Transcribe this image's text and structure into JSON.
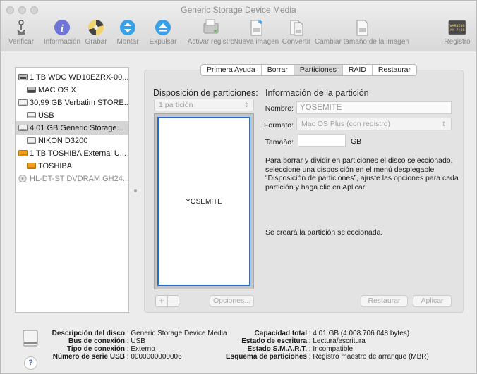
{
  "window": {
    "title": "Generic Storage Device Media"
  },
  "toolbar": {
    "items": [
      {
        "label": "Verificar",
        "icon": "stethoscope-icon"
      },
      {
        "label": "Información",
        "icon": "info-icon"
      },
      {
        "label": "Grabar",
        "icon": "burn-icon"
      },
      {
        "label": "Montar",
        "icon": "mount-icon"
      },
      {
        "label": "Expulsar",
        "icon": "eject-icon"
      },
      {
        "label": "Activar registro",
        "icon": "enable-journal-icon"
      },
      {
        "label": "Nueva imagen",
        "icon": "new-image-icon"
      },
      {
        "label": "Convertir",
        "icon": "convert-icon"
      },
      {
        "label": "Cambiar tamaño de la imagen",
        "icon": "resize-image-icon"
      },
      {
        "label": "Registro",
        "icon": "log-icon"
      }
    ],
    "log_icon_text": "WARNING\nAY 7:36"
  },
  "sidebar": {
    "items": [
      {
        "label": "1 TB WDC WD10EZRX-00...",
        "type": "internal-disk",
        "selected": false
      },
      {
        "label": "MAC OS X",
        "type": "volume",
        "selected": false
      },
      {
        "label": "30,99 GB Verbatim STORE...",
        "type": "external-disk",
        "selected": false
      },
      {
        "label": "USB",
        "type": "volume",
        "selected": false
      },
      {
        "label": "4,01 GB Generic Storage...",
        "type": "external-disk",
        "selected": true
      },
      {
        "label": "NIKON D3200",
        "type": "volume",
        "selected": false
      },
      {
        "label": "1 TB TOSHIBA External U...",
        "type": "orange-disk",
        "selected": false
      },
      {
        "label": "TOSHIBA",
        "type": "orange-volume",
        "selected": false
      },
      {
        "label": "HL-DT-ST DVDRAM GH24...",
        "type": "optical-drive",
        "selected": false
      }
    ]
  },
  "tabs": [
    {
      "label": "Primera Ayuda",
      "active": false
    },
    {
      "label": "Borrar",
      "active": false
    },
    {
      "label": "Particiones",
      "active": true
    },
    {
      "label": "RAID",
      "active": false
    },
    {
      "label": "Restaurar",
      "active": false
    }
  ],
  "partition": {
    "layout_title": "Disposición de particiones:",
    "layout_select": "1 partición",
    "partition_name": "YOSEMITE",
    "options_button": "Opciones...",
    "plus": "+",
    "minus": "—",
    "info_title": "Información de la partición",
    "name_label": "Nombre:",
    "name_value": "YOSEMITE",
    "format_label": "Formato:",
    "format_value": "Mac OS Plus (con registro)",
    "size_label": "Tamaño:",
    "size_value": "",
    "size_unit": "GB",
    "help_text": "Para borrar y dividir en particiones el disco seleccionado, seleccione una disposición en el menú desplegable “Disposición de particiones”, ajuste las opciones para cada partición y haga clic en Aplicar.",
    "status_text": "Se creará la partición seleccionada.",
    "restore_button": "Restaurar",
    "apply_button": "Aplicar"
  },
  "disk_info": {
    "left": [
      {
        "key": "Descripción del disco",
        "value": "Generic Storage Device Media"
      },
      {
        "key": "Bus de conexión",
        "value": "USB"
      },
      {
        "key": "Tipo de conexión",
        "value": "Externo"
      },
      {
        "key": "Número de serie USB",
        "value": "0000000000006"
      }
    ],
    "right": [
      {
        "key": "Capacidad total",
        "value": "4,01 GB (4.008.706.048 bytes)"
      },
      {
        "key": "Estado de escritura",
        "value": "Lectura/escritura"
      },
      {
        "key": "Estado S.M.A.R.T.",
        "value": "Incompatible"
      },
      {
        "key": "Esquema de particiones",
        "value": "Registro maestro de arranque (MBR)"
      }
    ],
    "help_label": "?"
  },
  "colors": {
    "accent": "#1e6fd6",
    "orange_disk": "#f0a020",
    "selected_row": "#d4d4d4"
  }
}
